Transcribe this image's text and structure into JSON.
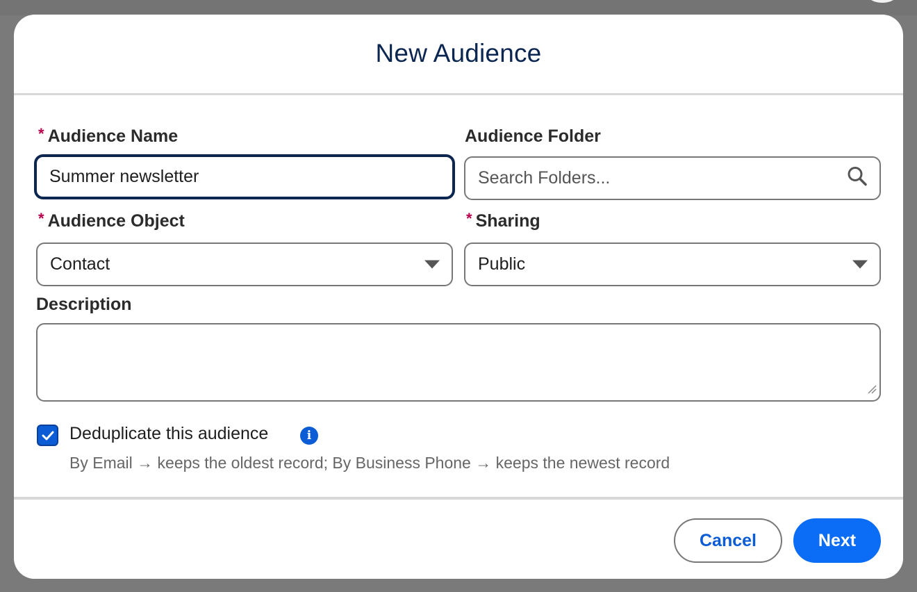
{
  "modal": {
    "title": "New Audience"
  },
  "form": {
    "audience_name": {
      "label": "Audience Name",
      "required_marker": "*",
      "value": "Summer newsletter"
    },
    "audience_folder": {
      "label": "Audience Folder",
      "placeholder": "Search Folders..."
    },
    "audience_object": {
      "label": "Audience Object",
      "required_marker": "*",
      "value": "Contact"
    },
    "sharing": {
      "label": "Sharing",
      "required_marker": "*",
      "value": "Public"
    },
    "description": {
      "label": "Description",
      "value": ""
    },
    "deduplicate": {
      "label": "Deduplicate this audience",
      "checked": true,
      "info_icon": "i",
      "helper": "By Email → keeps the oldest record; By Business Phone → keeps the newest record"
    }
  },
  "footer": {
    "cancel_label": "Cancel",
    "next_label": "Next"
  },
  "colors": {
    "brand_blue": "#0b6cf5",
    "title_navy": "#0b2650",
    "required_red": "#b8004c"
  },
  "icons": {
    "search": "search-icon",
    "dropdown": "chevron-down-icon",
    "info": "info-icon",
    "check": "checkmark-icon",
    "resize": "resize-handle-icon"
  }
}
